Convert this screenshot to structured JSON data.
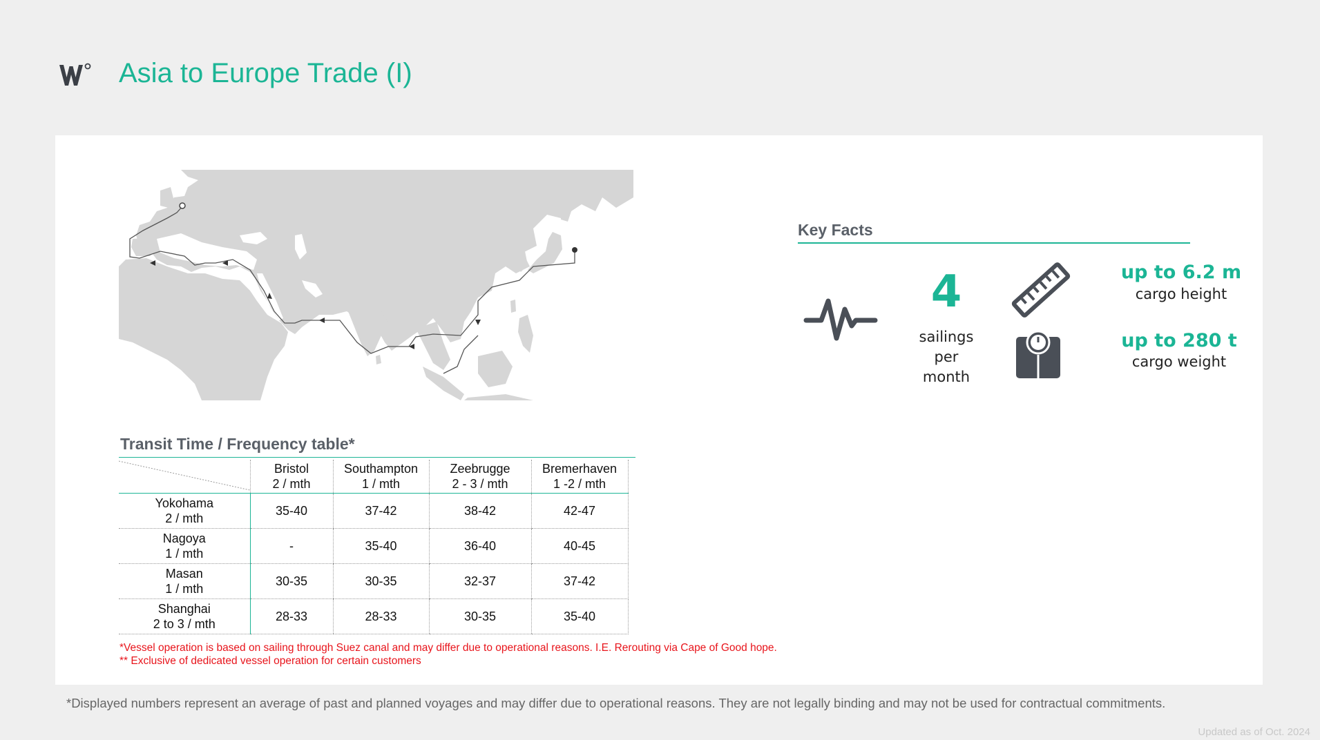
{
  "header": {
    "logo": "W°",
    "title": "Asia to Europe Trade (I)"
  },
  "map": {
    "description_icon": "route-map",
    "colors": {
      "land": "#d6d6d6",
      "route": "#555555"
    }
  },
  "table": {
    "title": "Transit Time / Frequency table*",
    "columns": [
      {
        "port": "Bristol",
        "freq": "2 / mth"
      },
      {
        "port": "Southampton",
        "freq": "1 / mth"
      },
      {
        "port": "Zeebrugge",
        "freq": "2 - 3 / mth"
      },
      {
        "port": "Bremerhaven",
        "freq": "1 -2 / mth"
      }
    ],
    "rows": [
      {
        "port": "Yokohama",
        "freq": "2 / mth",
        "values": [
          "35-40",
          "37-42",
          "38-42",
          "42-47"
        ]
      },
      {
        "port": "Nagoya",
        "freq": "1 / mth",
        "values": [
          "-",
          "35-40",
          "36-40",
          "40-45"
        ]
      },
      {
        "port": "Masan",
        "freq": "1 / mth",
        "values": [
          "30-35",
          "30-35",
          "32-37",
          "37-42"
        ]
      },
      {
        "port": "Shanghai",
        "freq": "2 to 3 / mth",
        "values": [
          "28-33",
          "28-33",
          "30-35",
          "35-40"
        ]
      }
    ],
    "note1": "*Vessel operation is based on sailing through Suez canal and may differ due to operational reasons. I.E. Rerouting via Cape of Good hope.",
    "note2": "** Exclusive of dedicated vessel operation for certain customers"
  },
  "key_facts": {
    "title": "Key Facts",
    "sailings_number": "4",
    "sailings_label_1": "sailings",
    "sailings_label_2": "per",
    "sailings_label_3": "month",
    "height_value": "up to 6.2 m",
    "height_label": "cargo height",
    "weight_value": "up to 280 t",
    "weight_label": "cargo weight",
    "accent_color": "#1bb595",
    "icons": [
      "pulse-icon",
      "ruler-icon",
      "scale-icon"
    ]
  },
  "footer": {
    "disclaimer": "*Displayed numbers represent an average of past and planned voyages and may differ due to operational reasons. They are not legally binding and may not be used for contractual commitments.",
    "updated": "Updated as of Oct. 2024"
  }
}
